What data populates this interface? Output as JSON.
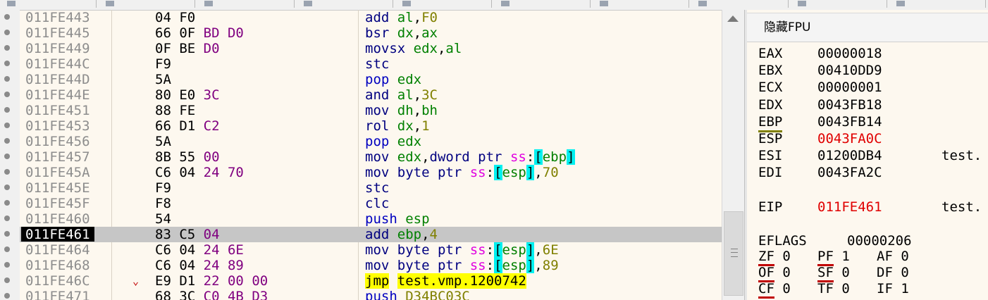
{
  "topbar_tabs": 10,
  "rows": [
    {
      "addr": "011FE443",
      "bytes": [
        "04",
        "F0"
      ],
      "instr": [
        {
          "t": "add ",
          "c": "m-navy"
        },
        {
          "t": "al",
          "c": "r-green"
        },
        {
          "t": ",",
          "c": ""
        },
        {
          "t": "F0",
          "c": "i-olive"
        }
      ]
    },
    {
      "addr": "011FE445",
      "bytes": [
        "66",
        "0F",
        "BD",
        "D0"
      ],
      "instr": [
        {
          "t": "bsr ",
          "c": "m-navy"
        },
        {
          "t": "dx",
          "c": "r-green"
        },
        {
          "t": ",",
          "c": ""
        },
        {
          "t": "ax",
          "c": "r-green"
        }
      ]
    },
    {
      "addr": "011FE449",
      "bytes": [
        "0F",
        "BE",
        "D0"
      ],
      "instr": [
        {
          "t": "movsx ",
          "c": "m-navy"
        },
        {
          "t": "edx",
          "c": "r-green"
        },
        {
          "t": ",",
          "c": ""
        },
        {
          "t": "al",
          "c": "r-green"
        }
      ]
    },
    {
      "addr": "011FE44C",
      "bytes": [
        "F9"
      ],
      "instr": [
        {
          "t": "stc",
          "c": "m-navy"
        }
      ]
    },
    {
      "addr": "011FE44D",
      "bytes": [
        "5A"
      ],
      "instr": [
        {
          "t": "pop ",
          "c": "m-blue"
        },
        {
          "t": "edx",
          "c": "r-green"
        }
      ]
    },
    {
      "addr": "011FE44E",
      "bytes": [
        "80",
        "E0",
        "3C"
      ],
      "instr": [
        {
          "t": "and ",
          "c": "m-navy"
        },
        {
          "t": "al",
          "c": "r-green"
        },
        {
          "t": ",",
          "c": ""
        },
        {
          "t": "3C",
          "c": "i-olive"
        }
      ]
    },
    {
      "addr": "011FE451",
      "bytes": [
        "88",
        "FE"
      ],
      "instr": [
        {
          "t": "mov ",
          "c": "m-navy"
        },
        {
          "t": "dh",
          "c": "r-green"
        },
        {
          "t": ",",
          "c": ""
        },
        {
          "t": "bh",
          "c": "r-green"
        }
      ]
    },
    {
      "addr": "011FE453",
      "bytes": [
        "66",
        "D1",
        "C2"
      ],
      "instr": [
        {
          "t": "rol ",
          "c": "m-navy"
        },
        {
          "t": "dx",
          "c": "r-green"
        },
        {
          "t": ",",
          "c": ""
        },
        {
          "t": "1",
          "c": "i-olive"
        }
      ]
    },
    {
      "addr": "011FE456",
      "bytes": [
        "5A"
      ],
      "instr": [
        {
          "t": "pop ",
          "c": "m-blue"
        },
        {
          "t": "edx",
          "c": "r-green"
        }
      ]
    },
    {
      "addr": "011FE457",
      "bytes": [
        "8B",
        "55",
        "00"
      ],
      "instr": [
        {
          "t": "mov ",
          "c": "m-navy"
        },
        {
          "t": "edx",
          "c": "r-green"
        },
        {
          "t": ",",
          "c": ""
        },
        {
          "t": "dword ptr ",
          "c": "m-navy"
        },
        {
          "t": "ss",
          "c": "s-mag"
        },
        {
          "t": ":",
          "c": ""
        },
        {
          "t": "[",
          "c": "br"
        },
        {
          "t": "ebp",
          "c": "r-green"
        },
        {
          "t": "]",
          "c": "br"
        }
      ]
    },
    {
      "addr": "011FE45A",
      "bytes": [
        "C6",
        "04",
        "24",
        "70"
      ],
      "instr": [
        {
          "t": "mov ",
          "c": "m-navy"
        },
        {
          "t": "byte ptr ",
          "c": "m-navy"
        },
        {
          "t": "ss",
          "c": "s-mag"
        },
        {
          "t": ":",
          "c": ""
        },
        {
          "t": "[",
          "c": "br"
        },
        {
          "t": "esp",
          "c": "r-green"
        },
        {
          "t": "]",
          "c": "br"
        },
        {
          "t": ",",
          "c": ""
        },
        {
          "t": "70",
          "c": "i-olive"
        }
      ]
    },
    {
      "addr": "011FE45E",
      "bytes": [
        "F9"
      ],
      "instr": [
        {
          "t": "stc",
          "c": "m-navy"
        }
      ]
    },
    {
      "addr": "011FE45F",
      "bytes": [
        "F8"
      ],
      "instr": [
        {
          "t": "clc",
          "c": "m-navy"
        }
      ]
    },
    {
      "addr": "011FE460",
      "bytes": [
        "54"
      ],
      "instr": [
        {
          "t": "push ",
          "c": "m-blue"
        },
        {
          "t": "esp",
          "c": "r-green"
        }
      ]
    },
    {
      "addr": "011FE461",
      "bytes": [
        "83",
        "C5",
        "04"
      ],
      "current": true,
      "instr": [
        {
          "t": "add ",
          "c": "m-navy"
        },
        {
          "t": "ebp",
          "c": "r-green"
        },
        {
          "t": ",",
          "c": ""
        },
        {
          "t": "4",
          "c": "i-olive"
        }
      ]
    },
    {
      "addr": "011FE464",
      "bytes": [
        "C6",
        "04",
        "24",
        "6E"
      ],
      "instr": [
        {
          "t": "mov ",
          "c": "m-navy"
        },
        {
          "t": "byte ptr ",
          "c": "m-navy"
        },
        {
          "t": "ss",
          "c": "s-mag"
        },
        {
          "t": ":",
          "c": ""
        },
        {
          "t": "[",
          "c": "br"
        },
        {
          "t": "esp",
          "c": "r-green"
        },
        {
          "t": "]",
          "c": "br"
        },
        {
          "t": ",",
          "c": ""
        },
        {
          "t": "6E",
          "c": "i-olive"
        }
      ]
    },
    {
      "addr": "011FE468",
      "bytes": [
        "C6",
        "04",
        "24",
        "89"
      ],
      "instr": [
        {
          "t": "mov ",
          "c": "m-navy"
        },
        {
          "t": "byte ptr ",
          "c": "m-navy"
        },
        {
          "t": "ss",
          "c": "s-mag"
        },
        {
          "t": ":",
          "c": ""
        },
        {
          "t": "[",
          "c": "br"
        },
        {
          "t": "esp",
          "c": "r-green"
        },
        {
          "t": "]",
          "c": "br"
        },
        {
          "t": ",",
          "c": ""
        },
        {
          "t": "89",
          "c": "i-olive"
        }
      ]
    },
    {
      "addr": "011FE46C",
      "bytes": [
        "E9",
        "D1",
        "22",
        "00",
        "00"
      ],
      "jmp": true,
      "instr": [
        {
          "t": "jmp",
          "c": "hl-y"
        },
        {
          "t": " ",
          "c": ""
        },
        {
          "t": "test.vmp.1200742",
          "c": "hl-y"
        }
      ]
    },
    {
      "addr": "011FE471",
      "bytes": [
        "68",
        "3C",
        "C0",
        "4B",
        "D3"
      ],
      "instr": [
        {
          "t": "push ",
          "c": "m-blue"
        },
        {
          "t": "D34BC03C",
          "c": "i-olive"
        }
      ]
    }
  ],
  "fpu_button": "隐藏FPU",
  "registers": [
    {
      "name": "EAX",
      "value": "00000018",
      "comment": ""
    },
    {
      "name": "EBX",
      "value": "00410DD9",
      "comment": ""
    },
    {
      "name": "ECX",
      "value": "00000001",
      "comment": ""
    },
    {
      "name": "EDX",
      "value": "0043FB18",
      "comment": ""
    },
    {
      "name": "EBP",
      "value": "0043FB14",
      "comment": "",
      "underline": true
    },
    {
      "name": "ESP",
      "value": "0043FA0C",
      "comment": "",
      "red": true
    },
    {
      "name": "ESI",
      "value": "01200DB4",
      "comment": "test."
    },
    {
      "name": "EDI",
      "value": "0043FA2C",
      "comment": ""
    }
  ],
  "eip": {
    "name": "EIP",
    "value": "011FE461",
    "comment": "test."
  },
  "eflags": {
    "name": "EFLAGS",
    "value": "00000206"
  },
  "flags": [
    [
      {
        "n": "ZF",
        "v": "0",
        "u": true
      },
      {
        "n": "PF",
        "v": "1",
        "u": true
      },
      {
        "n": "AF",
        "v": "0",
        "u": false
      }
    ],
    [
      {
        "n": "OF",
        "v": "0",
        "u": true
      },
      {
        "n": "SF",
        "v": "0",
        "u": true
      },
      {
        "n": "DF",
        "v": "0",
        "u": false
      }
    ],
    [
      {
        "n": "CF",
        "v": "0",
        "u": true
      },
      {
        "n": "TF",
        "v": "0",
        "u": false
      },
      {
        "n": "IF",
        "v": "1",
        "u": false
      }
    ]
  ]
}
